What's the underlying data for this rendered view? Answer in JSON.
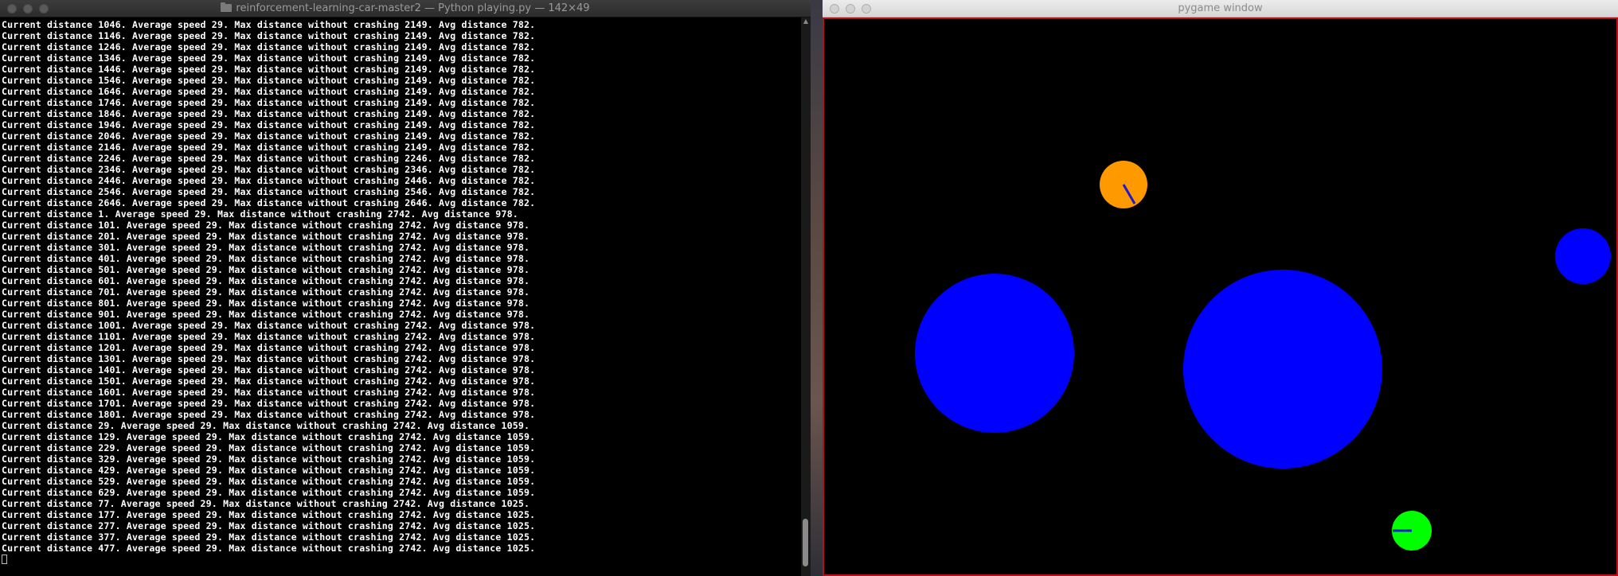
{
  "terminal": {
    "title": "reinforcement-learning-car-master2 — Python playing.py — 142×49",
    "lines": [
      "Current distance 1046. Average speed 29. Max distance without crashing 2149. Avg distance 782.",
      "Current distance 1146. Average speed 29. Max distance without crashing 2149. Avg distance 782.",
      "Current distance 1246. Average speed 29. Max distance without crashing 2149. Avg distance 782.",
      "Current distance 1346. Average speed 29. Max distance without crashing 2149. Avg distance 782.",
      "Current distance 1446. Average speed 29. Max distance without crashing 2149. Avg distance 782.",
      "Current distance 1546. Average speed 29. Max distance without crashing 2149. Avg distance 782.",
      "Current distance 1646. Average speed 29. Max distance without crashing 2149. Avg distance 782.",
      "Current distance 1746. Average speed 29. Max distance without crashing 2149. Avg distance 782.",
      "Current distance 1846. Average speed 29. Max distance without crashing 2149. Avg distance 782.",
      "Current distance 1946. Average speed 29. Max distance without crashing 2149. Avg distance 782.",
      "Current distance 2046. Average speed 29. Max distance without crashing 2149. Avg distance 782.",
      "Current distance 2146. Average speed 29. Max distance without crashing 2149. Avg distance 782.",
      "Current distance 2246. Average speed 29. Max distance without crashing 2246. Avg distance 782.",
      "Current distance 2346. Average speed 29. Max distance without crashing 2346. Avg distance 782.",
      "Current distance 2446. Average speed 29. Max distance without crashing 2446. Avg distance 782.",
      "Current distance 2546. Average speed 29. Max distance without crashing 2546. Avg distance 782.",
      "Current distance 2646. Average speed 29. Max distance without crashing 2646. Avg distance 782.",
      "Current distance 1. Average speed 29. Max distance without crashing 2742. Avg distance 978.",
      "Current distance 101. Average speed 29. Max distance without crashing 2742. Avg distance 978.",
      "Current distance 201. Average speed 29. Max distance without crashing 2742. Avg distance 978.",
      "Current distance 301. Average speed 29. Max distance without crashing 2742. Avg distance 978.",
      "Current distance 401. Average speed 29. Max distance without crashing 2742. Avg distance 978.",
      "Current distance 501. Average speed 29. Max distance without crashing 2742. Avg distance 978.",
      "Current distance 601. Average speed 29. Max distance without crashing 2742. Avg distance 978.",
      "Current distance 701. Average speed 29. Max distance without crashing 2742. Avg distance 978.",
      "Current distance 801. Average speed 29. Max distance without crashing 2742. Avg distance 978.",
      "Current distance 901. Average speed 29. Max distance without crashing 2742. Avg distance 978.",
      "Current distance 1001. Average speed 29. Max distance without crashing 2742. Avg distance 978.",
      "Current distance 1101. Average speed 29. Max distance without crashing 2742. Avg distance 978.",
      "Current distance 1201. Average speed 29. Max distance without crashing 2742. Avg distance 978.",
      "Current distance 1301. Average speed 29. Max distance without crashing 2742. Avg distance 978.",
      "Current distance 1401. Average speed 29. Max distance without crashing 2742. Avg distance 978.",
      "Current distance 1501. Average speed 29. Max distance without crashing 2742. Avg distance 978.",
      "Current distance 1601. Average speed 29. Max distance without crashing 2742. Avg distance 978.",
      "Current distance 1701. Average speed 29. Max distance without crashing 2742. Avg distance 978.",
      "Current distance 1801. Average speed 29. Max distance without crashing 2742. Avg distance 978.",
      "Current distance 29. Average speed 29. Max distance without crashing 2742. Avg distance 1059.",
      "Current distance 129. Average speed 29. Max distance without crashing 2742. Avg distance 1059.",
      "Current distance 229. Average speed 29. Max distance without crashing 2742. Avg distance 1059.",
      "Current distance 329. Average speed 29. Max distance without crashing 2742. Avg distance 1059.",
      "Current distance 429. Average speed 29. Max distance without crashing 2742. Avg distance 1059.",
      "Current distance 529. Average speed 29. Max distance without crashing 2742. Avg distance 1059.",
      "Current distance 629. Average speed 29. Max distance without crashing 2742. Avg distance 1059.",
      "Current distance 77. Average speed 29. Max distance without crashing 2742. Avg distance 1025.",
      "Current distance 177. Average speed 29. Max distance without crashing 2742. Avg distance 1025.",
      "Current distance 277. Average speed 29. Max distance without crashing 2742. Avg distance 1025.",
      "Current distance 377. Average speed 29. Max distance without crashing 2742. Avg distance 1025.",
      "Current distance 477. Average speed 29. Max distance without crashing 2742. Avg distance 1025."
    ]
  },
  "game_window": {
    "title": "pygame window",
    "colors": {
      "background": "#000000",
      "border": "#b51218",
      "obstacle": "#0000ff",
      "cat": "#ff9900",
      "car": "#00ff00",
      "heading_line": "#1a1ad0"
    },
    "entities": [
      "orange-cat",
      "blue-obstacle-small",
      "blue-obstacle-left",
      "blue-obstacle-right",
      "green-car"
    ]
  }
}
